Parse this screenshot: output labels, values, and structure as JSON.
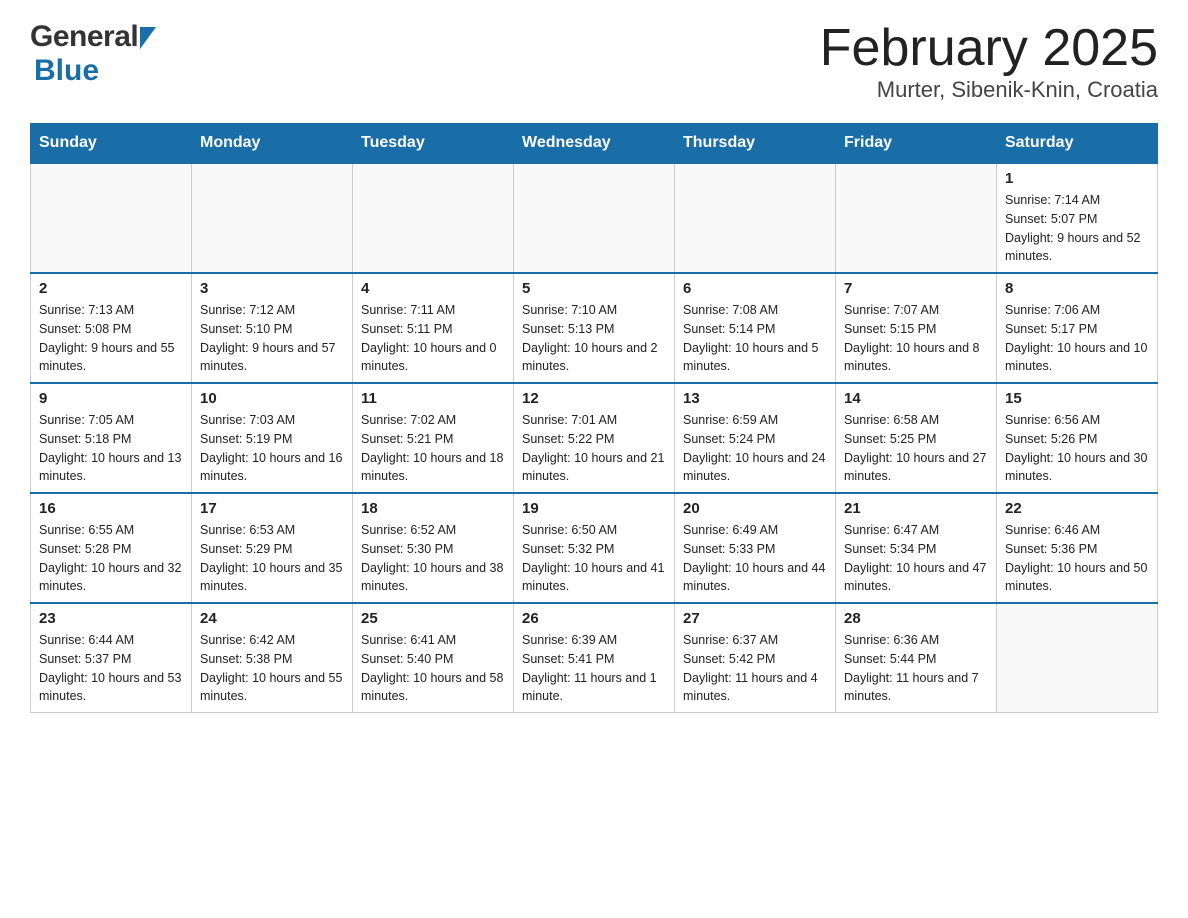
{
  "header": {
    "logo_general": "General",
    "logo_blue": "Blue",
    "title": "February 2025",
    "subtitle": "Murter, Sibenik-Knin, Croatia"
  },
  "calendar": {
    "days_of_week": [
      "Sunday",
      "Monday",
      "Tuesday",
      "Wednesday",
      "Thursday",
      "Friday",
      "Saturday"
    ],
    "weeks": [
      [
        {
          "day": "",
          "info": ""
        },
        {
          "day": "",
          "info": ""
        },
        {
          "day": "",
          "info": ""
        },
        {
          "day": "",
          "info": ""
        },
        {
          "day": "",
          "info": ""
        },
        {
          "day": "",
          "info": ""
        },
        {
          "day": "1",
          "info": "Sunrise: 7:14 AM\nSunset: 5:07 PM\nDaylight: 9 hours and 52 minutes."
        }
      ],
      [
        {
          "day": "2",
          "info": "Sunrise: 7:13 AM\nSunset: 5:08 PM\nDaylight: 9 hours and 55 minutes."
        },
        {
          "day": "3",
          "info": "Sunrise: 7:12 AM\nSunset: 5:10 PM\nDaylight: 9 hours and 57 minutes."
        },
        {
          "day": "4",
          "info": "Sunrise: 7:11 AM\nSunset: 5:11 PM\nDaylight: 10 hours and 0 minutes."
        },
        {
          "day": "5",
          "info": "Sunrise: 7:10 AM\nSunset: 5:13 PM\nDaylight: 10 hours and 2 minutes."
        },
        {
          "day": "6",
          "info": "Sunrise: 7:08 AM\nSunset: 5:14 PM\nDaylight: 10 hours and 5 minutes."
        },
        {
          "day": "7",
          "info": "Sunrise: 7:07 AM\nSunset: 5:15 PM\nDaylight: 10 hours and 8 minutes."
        },
        {
          "day": "8",
          "info": "Sunrise: 7:06 AM\nSunset: 5:17 PM\nDaylight: 10 hours and 10 minutes."
        }
      ],
      [
        {
          "day": "9",
          "info": "Sunrise: 7:05 AM\nSunset: 5:18 PM\nDaylight: 10 hours and 13 minutes."
        },
        {
          "day": "10",
          "info": "Sunrise: 7:03 AM\nSunset: 5:19 PM\nDaylight: 10 hours and 16 minutes."
        },
        {
          "day": "11",
          "info": "Sunrise: 7:02 AM\nSunset: 5:21 PM\nDaylight: 10 hours and 18 minutes."
        },
        {
          "day": "12",
          "info": "Sunrise: 7:01 AM\nSunset: 5:22 PM\nDaylight: 10 hours and 21 minutes."
        },
        {
          "day": "13",
          "info": "Sunrise: 6:59 AM\nSunset: 5:24 PM\nDaylight: 10 hours and 24 minutes."
        },
        {
          "day": "14",
          "info": "Sunrise: 6:58 AM\nSunset: 5:25 PM\nDaylight: 10 hours and 27 minutes."
        },
        {
          "day": "15",
          "info": "Sunrise: 6:56 AM\nSunset: 5:26 PM\nDaylight: 10 hours and 30 minutes."
        }
      ],
      [
        {
          "day": "16",
          "info": "Sunrise: 6:55 AM\nSunset: 5:28 PM\nDaylight: 10 hours and 32 minutes."
        },
        {
          "day": "17",
          "info": "Sunrise: 6:53 AM\nSunset: 5:29 PM\nDaylight: 10 hours and 35 minutes."
        },
        {
          "day": "18",
          "info": "Sunrise: 6:52 AM\nSunset: 5:30 PM\nDaylight: 10 hours and 38 minutes."
        },
        {
          "day": "19",
          "info": "Sunrise: 6:50 AM\nSunset: 5:32 PM\nDaylight: 10 hours and 41 minutes."
        },
        {
          "day": "20",
          "info": "Sunrise: 6:49 AM\nSunset: 5:33 PM\nDaylight: 10 hours and 44 minutes."
        },
        {
          "day": "21",
          "info": "Sunrise: 6:47 AM\nSunset: 5:34 PM\nDaylight: 10 hours and 47 minutes."
        },
        {
          "day": "22",
          "info": "Sunrise: 6:46 AM\nSunset: 5:36 PM\nDaylight: 10 hours and 50 minutes."
        }
      ],
      [
        {
          "day": "23",
          "info": "Sunrise: 6:44 AM\nSunset: 5:37 PM\nDaylight: 10 hours and 53 minutes."
        },
        {
          "day": "24",
          "info": "Sunrise: 6:42 AM\nSunset: 5:38 PM\nDaylight: 10 hours and 55 minutes."
        },
        {
          "day": "25",
          "info": "Sunrise: 6:41 AM\nSunset: 5:40 PM\nDaylight: 10 hours and 58 minutes."
        },
        {
          "day": "26",
          "info": "Sunrise: 6:39 AM\nSunset: 5:41 PM\nDaylight: 11 hours and 1 minute."
        },
        {
          "day": "27",
          "info": "Sunrise: 6:37 AM\nSunset: 5:42 PM\nDaylight: 11 hours and 4 minutes."
        },
        {
          "day": "28",
          "info": "Sunrise: 6:36 AM\nSunset: 5:44 PM\nDaylight: 11 hours and 7 minutes."
        },
        {
          "day": "",
          "info": ""
        }
      ]
    ]
  }
}
